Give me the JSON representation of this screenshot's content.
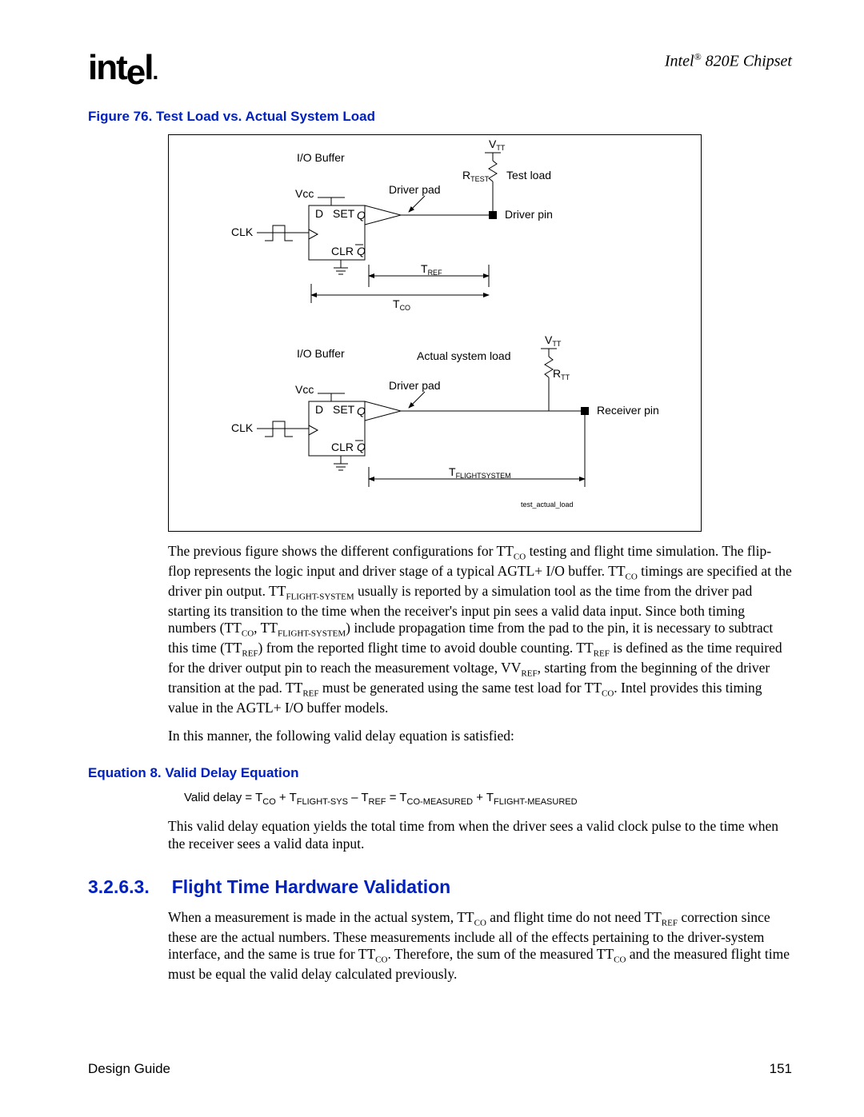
{
  "header": {
    "logo": "intel",
    "chipset_prefix": "Intel",
    "chipset_reg": "®",
    "chipset_suffix": " 820E Chipset"
  },
  "figure": {
    "caption": "Figure 76. Test Load vs. Actual System Load",
    "labels": {
      "io_buffer": "I/O Buffer",
      "vtt": "V",
      "vtt_sub": "TT",
      "vcc": "Vcc",
      "clk": "CLK",
      "d": "D",
      "set": "SET",
      "q": "Q",
      "clr": "CLR",
      "qbar": "Q",
      "driver_pad": "Driver pad",
      "rtest": "R",
      "rtest_sub": "TEST",
      "test_load": "Test load",
      "driver_pin": "Driver pin",
      "tref": "T",
      "tref_sub": "REF",
      "tco": "T",
      "tco_sub": "CO",
      "actual_load": "Actual system load",
      "rtt": "R",
      "rtt_sub": "TT",
      "receiver_pin": "Receiver pin",
      "tflight": "T",
      "tflight_sub": "FLIGHTSYSTEM",
      "footer_tag": "test_actual_load"
    }
  },
  "paragraphs": {
    "p1a": "The previous figure shows the different configurations for T",
    "p1b": " testing and flight time simulation. The flip-flop represents the logic input and driver stage of a typical AGTL+ I/O buffer. T",
    "p1c": " timings are specified at the driver pin output. T",
    "p1d": " usually is reported by a simulation tool as the time from the driver pad starting its transition to the time when the receiver's input pin sees a valid data input. Since both timing numbers (T",
    "p1e": ", T",
    "p1f": ") include propagation time from the pad to the pin, it is necessary to subtract this time (T",
    "p1g": ") from the reported flight time to avoid double counting. T",
    "p1h": " is defined as the time required for the driver output pin to reach the measurement voltage, V",
    "p1i": ", starting from the beginning of the driver transition at the pad. T",
    "p1j": " must be generated using the same test load for T",
    "p1k": ". Intel provides this timing value in the AGTL+ I/O buffer models.",
    "p2": "In this manner, the following valid delay equation is satisfied:",
    "p3": "This valid delay equation yields the total time from when the driver sees a valid clock pulse to the time when the receiver sees a valid data input.",
    "p4a": "When a measurement is made in the actual system, T",
    "p4b": " and flight time do not need T",
    "p4c": " correction since these are the actual numbers. These measurements include all of the effects pertaining to the driver-system interface, and the same is true for T",
    "p4d": ". Therefore, the sum of the measured T",
    "p4e": " and the measured flight time must be equal the valid delay calculated previously.",
    "sub_co": "CO",
    "sub_ref": "REF",
    "sub_flightsys": "FLIGHT-SYSTEM",
    "sub_vref": "REF"
  },
  "equation": {
    "caption": "Equation 8. Valid Delay Equation",
    "e1": "Valid delay = T",
    "e2": " + T",
    "e3": " – T",
    "e4": " = T",
    "e5": " + T",
    "sub_co": "CO",
    "sub_flightsys": "FLIGHT-SYS",
    "sub_ref": "REF",
    "sub_comeas": "CO-MEASURED",
    "sub_flightmeas": "FLIGHT-MEASURED"
  },
  "section": {
    "number": "3.2.6.3.",
    "title": "Flight Time Hardware Validation"
  },
  "footer": {
    "left": "Design Guide",
    "right": "151"
  }
}
